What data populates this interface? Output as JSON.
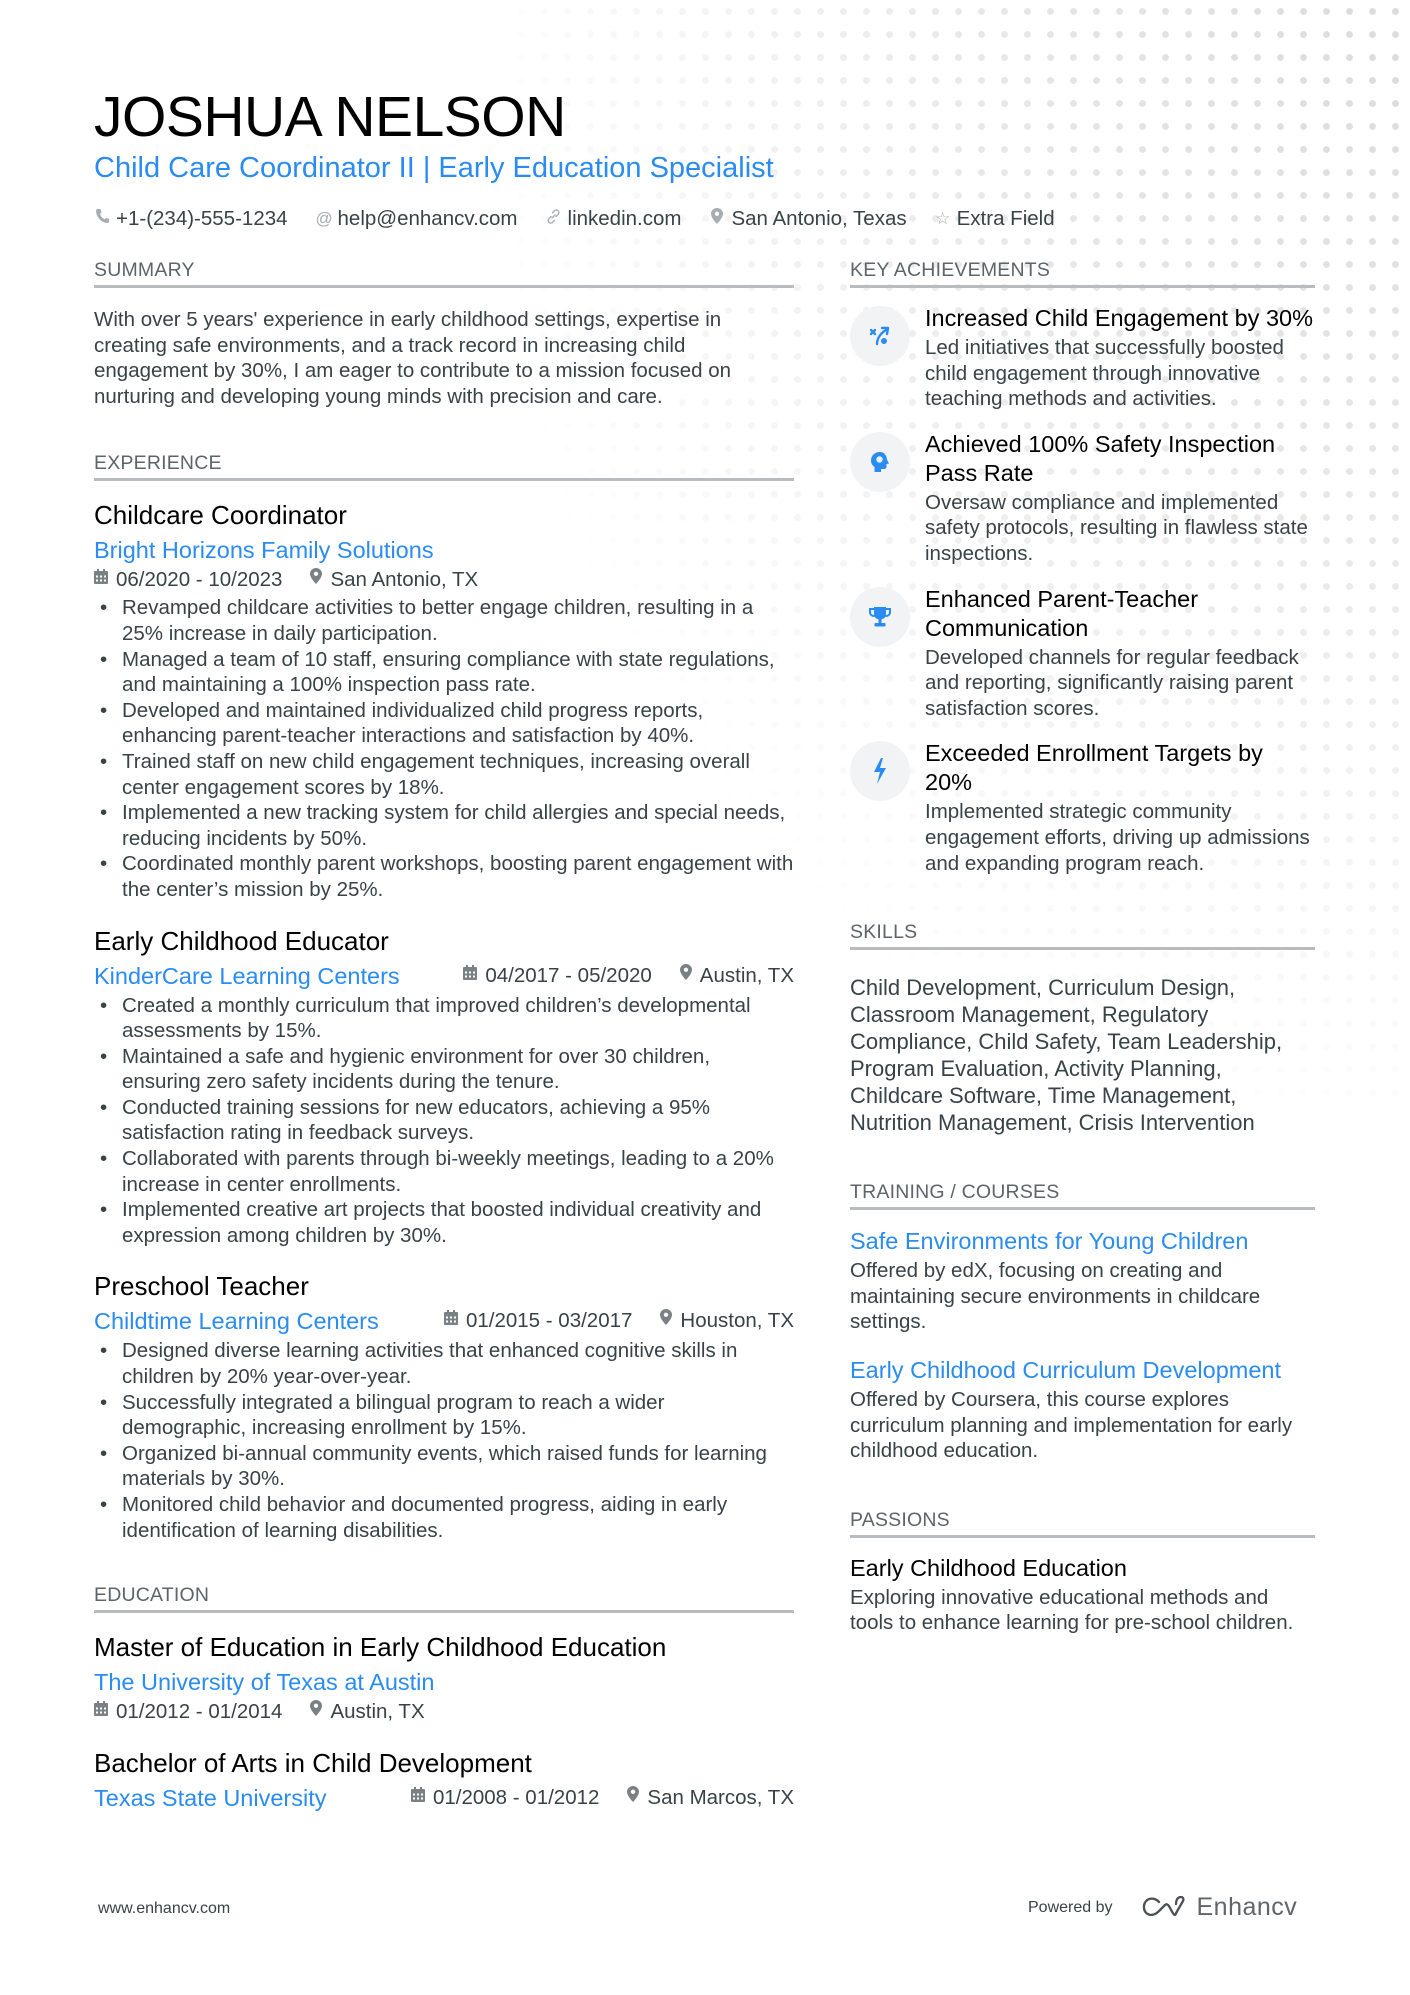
{
  "header": {
    "name": "JOSHUA NELSON",
    "subtitle": "Child Care Coordinator II | Early Education Specialist",
    "contacts": [
      {
        "icon": "phone-icon",
        "text": "+1-(234)-555-1234"
      },
      {
        "icon": "at-icon",
        "text": "help@enhancv.com"
      },
      {
        "icon": "link-icon",
        "text": "linkedin.com"
      },
      {
        "icon": "location-icon",
        "text": "San Antonio, Texas"
      },
      {
        "icon": "star-icon",
        "text": "Extra Field"
      }
    ]
  },
  "summary": {
    "title": "SUMMARY",
    "text": "With over 5 years' experience in early childhood settings, expertise in creating safe environments, and a track record in increasing child engagement by 30%, I am eager to contribute to a mission focused on nurturing and developing young minds with precision and care."
  },
  "experience": {
    "title": "EXPERIENCE",
    "jobs": [
      {
        "title": "Childcare Coordinator",
        "company": "Bright Horizons Family Solutions",
        "dates": "06/2020 - 10/2023",
        "location": "San Antonio, TX",
        "bullets": [
          "Revamped childcare activities to better engage children, resulting in a 25% increase in daily participation.",
          "Managed a team of 10 staff, ensuring compliance with state regulations, and maintaining a 100% inspection pass rate.",
          "Developed and maintained individualized child progress reports, enhancing parent-teacher interactions and satisfaction by 40%.",
          "Trained staff on new child engagement techniques, increasing overall center engagement scores by 18%.",
          "Implemented a new tracking system for child allergies and special needs, reducing incidents by 50%.",
          "Coordinated monthly parent workshops, boosting parent engagement with the center’s mission by 25%."
        ]
      },
      {
        "title": "Early Childhood Educator",
        "company": "KinderCare Learning Centers",
        "dates": "04/2017 - 05/2020",
        "location": "Austin, TX",
        "bullets": [
          "Created a monthly curriculum that improved children’s developmental assessments by 15%.",
          "Maintained a safe and hygienic environment for over 30 children, ensuring zero safety incidents during the tenure.",
          "Conducted training sessions for new educators, achieving a 95% satisfaction rating in feedback surveys.",
          "Collaborated with parents through bi-weekly meetings, leading to a 20% increase in center enrollments.",
          "Implemented creative art projects that boosted individual creativity and expression among children by 30%."
        ]
      },
      {
        "title": "Preschool Teacher",
        "company": "Childtime Learning Centers",
        "dates": "01/2015 - 03/2017",
        "location": "Houston, TX",
        "bullets": [
          "Designed diverse learning activities that enhanced cognitive skills in children by 20% year-over-year.",
          "Successfully integrated a bilingual program to reach a wider demographic, increasing enrollment by 15%.",
          "Organized bi-annual community events, which raised funds for learning materials by 30%.",
          "Monitored child behavior and documented progress, aiding in early identification of learning disabilities."
        ]
      }
    ]
  },
  "education": {
    "title": "EDUCATION",
    "items": [
      {
        "degree": "Master of Education in Early Childhood Education",
        "school": "The University of Texas at Austin",
        "dates": "01/2012 - 01/2014",
        "location": "Austin, TX"
      },
      {
        "degree": "Bachelor of Arts in Child Development",
        "school": "Texas State University",
        "dates": "01/2008 - 01/2012",
        "location": "San Marcos, TX"
      }
    ]
  },
  "achievements": {
    "title": "KEY ACHIEVEMENTS",
    "items": [
      {
        "icon": "strategy-icon",
        "title": "Increased Child Engagement by 30%",
        "desc": "Led initiatives that successfully boosted child engagement through innovative teaching methods and activities."
      },
      {
        "icon": "head-idea-icon",
        "title": "Achieved 100% Safety Inspection Pass Rate",
        "desc": "Oversaw compliance and implemented safety protocols, resulting in flawless state inspections."
      },
      {
        "icon": "trophy-icon",
        "title": "Enhanced Parent-Teacher Communication",
        "desc": "Developed channels for regular feedback and reporting, significantly raising parent satisfaction scores."
      },
      {
        "icon": "lightning-icon",
        "title": "Exceeded Enrollment Targets by 20%",
        "desc": "Implemented strategic community engagement efforts, driving up admissions and expanding program reach."
      }
    ]
  },
  "skills": {
    "title": "SKILLS",
    "text": "Child Development, Curriculum Design, Classroom Management, Regulatory Compliance, Child Safety, Team Leadership, Program Evaluation, Activity Planning, Childcare Software, Time Management, Nutrition Management, Crisis Intervention"
  },
  "training": {
    "title": "TRAINING / COURSES",
    "items": [
      {
        "title": "Safe Environments for Young Children",
        "desc": "Offered by edX, focusing on creating and maintaining secure environments in childcare settings."
      },
      {
        "title": "Early Childhood Curriculum Development",
        "desc": "Offered by Coursera, this course explores curriculum planning and implementation for early childhood education."
      }
    ]
  },
  "passions": {
    "title": "PASSIONS",
    "items": [
      {
        "title": "Early Childhood Education",
        "desc": "Exploring innovative educational methods and tools to enhance learning for pre-school children."
      }
    ]
  },
  "footer": {
    "website": "www.enhancv.com",
    "powered_by": "Powered by",
    "brand": "Enhancv"
  },
  "colors": {
    "accent": "#2a8cf0",
    "text": "#384347",
    "heading": "#000000",
    "section_line": "#b9bcbe",
    "icon_bg": "#f2f3f4"
  }
}
